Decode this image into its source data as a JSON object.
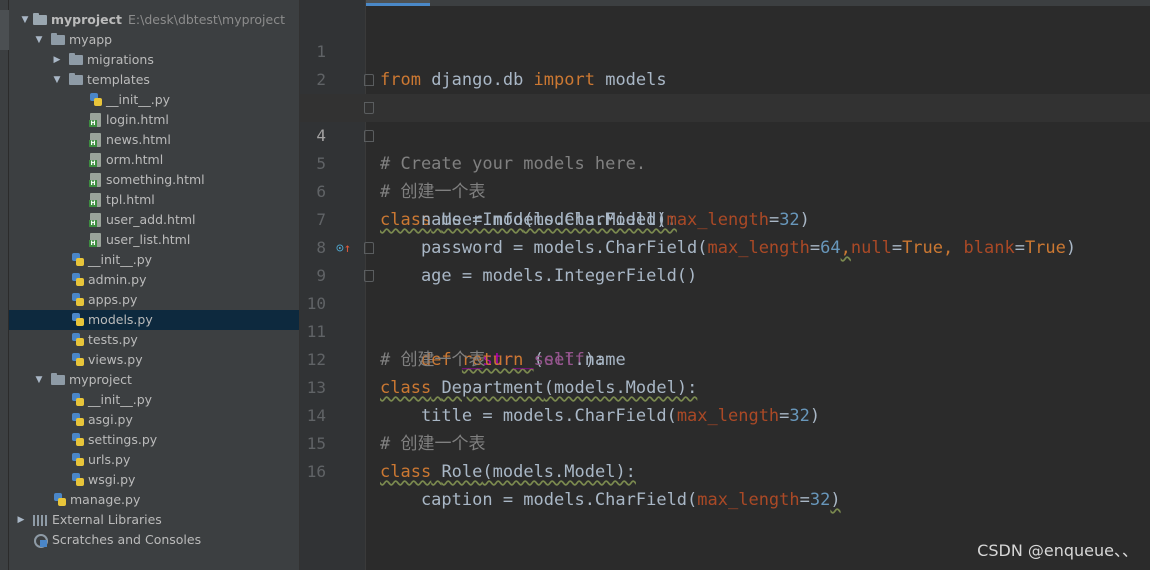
{
  "project_tree": {
    "root": {
      "name": "myproject",
      "path": "E:\\desk\\dbtest\\myproject"
    },
    "items": [
      {
        "label": "myapp"
      },
      {
        "label": "migrations"
      },
      {
        "label": "templates"
      },
      {
        "label": "__init__.py"
      },
      {
        "label": "login.html"
      },
      {
        "label": "news.html"
      },
      {
        "label": "orm.html"
      },
      {
        "label": "something.html"
      },
      {
        "label": "tpl.html"
      },
      {
        "label": "user_add.html"
      },
      {
        "label": "user_list.html"
      },
      {
        "label": "__init__.py"
      },
      {
        "label": "admin.py"
      },
      {
        "label": "apps.py"
      },
      {
        "label": "models.py"
      },
      {
        "label": "tests.py"
      },
      {
        "label": "views.py"
      },
      {
        "label": "myproject"
      },
      {
        "label": "__init__.py"
      },
      {
        "label": "asgi.py"
      },
      {
        "label": "settings.py"
      },
      {
        "label": "urls.py"
      },
      {
        "label": "wsgi.py"
      },
      {
        "label": "manage.py"
      },
      {
        "label": "External Libraries"
      },
      {
        "label": "Scratches and Consoles"
      }
    ]
  },
  "editor": {
    "line_numbers": [
      "1",
      "2",
      "3",
      "4",
      "5",
      "6",
      "7",
      "8",
      "9",
      "10",
      "11",
      "12",
      "13",
      "14",
      "15",
      "16"
    ],
    "code": {
      "l1": {
        "from": "from",
        "mod": " django.db ",
        "import": "import",
        "name": " models"
      },
      "l3": "# Create your models here.",
      "l4": "# 创建一个表",
      "l5": {
        "kw": "class",
        "name": "UserInfo",
        "base": "(models.Model):"
      },
      "l6": {
        "a": "    name = models.CharField(",
        "p": "max_length",
        "eq": "=",
        "n": "32",
        "c": ")"
      },
      "l7": {
        "a": "    password = models.CharField(",
        "p1": "max_length",
        "eq1": "=",
        "n1": "64",
        "comma1": ",",
        "p2": "null",
        "eq2": "=",
        "v2": "True",
        "comma2": ", ",
        "p3": "blank",
        "eq3": "=",
        "v3": "True",
        "c": ")"
      },
      "l8": "    age = models.IntegerField()",
      "l9": {
        "indent": "    ",
        "kw": "def",
        "sp": " ",
        "fn": "__str__",
        "o": "(",
        "self": "self",
        "c": "):"
      },
      "l10": {
        "indent": "        ",
        "kw": "return",
        "sp": " ",
        "self": "self",
        "rest": ".name"
      },
      "l11": "# 创建一个表",
      "l12": {
        "kw": "class",
        "name": "Department",
        "base": "(models.Model):"
      },
      "l13": {
        "a": "    title = models.CharField(",
        "p": "max_length",
        "eq": "=",
        "n": "32",
        "c": ")"
      },
      "l14": "# 创建一个表",
      "l15": {
        "kw": "class",
        "name": "Role",
        "base": "(models.Model):"
      },
      "l16": {
        "a": "    caption = models.CharField(",
        "p": "max_length",
        "eq": "=",
        "n": "32",
        "c": ")"
      }
    }
  },
  "watermark": "CSDN @enqueue、、",
  "colors": {
    "keyword": "#cc7832",
    "comment": "#808080",
    "number": "#6897bb",
    "param": "#aa4926",
    "self": "#94558d",
    "magic": "#b200b2",
    "selection": "#0d293e"
  }
}
